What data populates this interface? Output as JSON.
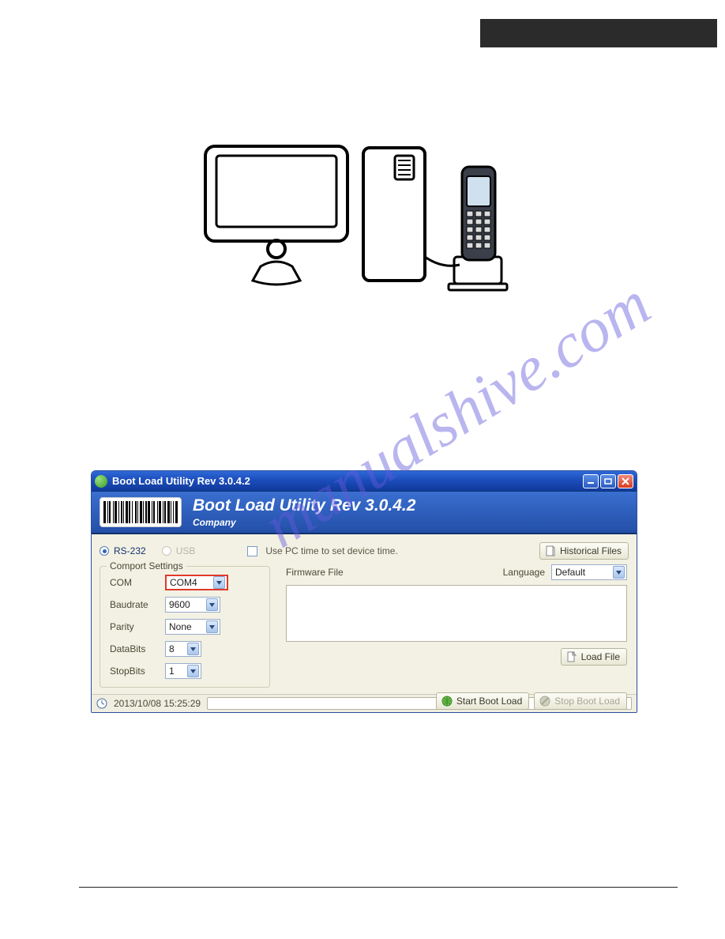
{
  "watermark": "manualshive.com",
  "window": {
    "title": "Boot Load Utility Rev 3.0.4.2",
    "banner_title": "Boot Load Utility Rev 3.0.4.2",
    "banner_sub": "Company",
    "radio_rs232": "RS-232",
    "radio_usb": "USB",
    "use_pc_time": "Use PC time to set device time.",
    "btn_hist": "Historical Files",
    "btn_load": "Load File",
    "btn_start": "Start Boot Load",
    "btn_stop": "Stop Boot Load",
    "comport_legend": "Comport Settings",
    "com_label": "COM",
    "com_value": "COM4",
    "baud_label": "Baudrate",
    "baud_value": "9600",
    "parity_label": "Parity",
    "parity_value": "None",
    "databits_label": "DataBits",
    "databits_value": "8",
    "stopbits_label": "StopBits",
    "stopbits_value": "1",
    "fw_label": "Firmware File",
    "lang_label": "Language",
    "lang_value": "Default",
    "status_time": "2013/10/08 15:25:29"
  }
}
